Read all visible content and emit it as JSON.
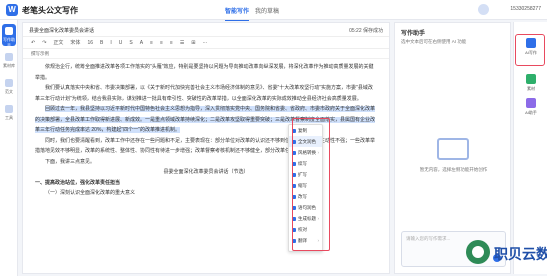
{
  "app": {
    "title": "老笔头公文写作",
    "logo": "W"
  },
  "tabs": [
    {
      "label": "智能写作"
    },
    {
      "label": "我的草稿"
    }
  ],
  "user": {
    "id": "15330258277"
  },
  "leftnav": [
    {
      "label": "写作助手"
    },
    {
      "label": "素材库"
    },
    {
      "label": "范文"
    },
    {
      "label": "工具"
    }
  ],
  "editor": {
    "doc_title": "县委全面深化改革委员会讲话",
    "save_time": "05:22 保存成功",
    "toolbar": [
      "↶",
      "↷",
      "正文",
      "宋体",
      "16",
      "B",
      "I",
      "U",
      "S",
      "A",
      "≡",
      "≡",
      "≡",
      "☰",
      "⊞",
      "⋯"
    ],
    "subbar": "撰写示例",
    "paragraphs": [
      {
        "text": "依规治企行，统筹全面推进改革各项工作落实的\"头雁\"效应，特别是要坚持以问题为导向推动改革向纵深发展，将深化改革作为推动高质量发展的关键举措。",
        "hl": false
      },
      {
        "text": "我们要认真落实中央和省、市委决策部署，以《关于新时代加快完善社会主义市场经济体制的意见》、省委\"十大改革攻坚行动\"实施方案，市委\"县域改革三年行动计划\"为统领，结合我县实际，谋划推进一批具有牵引性、突破性的改革举措，以全面深化改革的实际成效推动全县经济社会高质量发展。",
        "hl": false
      },
      {
        "text": "回顾过去一年，我县坚持以习近平新时代中国特色社会主义思想为指导，深入贯彻落实党中央、国务院和省委、省政府、市委市政府关于全面深化改革的决策部署，全县改革工作取得新进展、新成效。一是重点领域改革持续深化；二是改革攻坚取得重要突破；三是改革督察制度全面落实，县属国有企业改革三年行动任务完成率达 20%，构建起\"四个一\"的改革推进机制。",
        "hl": true
      },
      {
        "text": "同时，我们也要清醒看到，改革工作中还存在一些问题和不足，主要表现在：部分单位对改革的认识还不够到位，推进改革的主动性不强；一些改革举措落地见效不够明显，改革的系统性、整体性、协同性有待进一步增强；改革督察考核机制还不够健全，部分改革任务推进缓慢。",
        "hl": false
      },
      {
        "text": "下面，我讲三点意见。",
        "hl": false
      },
      {
        "text": "一、提高政治站位，强化改革责任担当",
        "hl": false,
        "bold": true
      },
      {
        "text": "（一）深刻认识全面深化改革的重大意义",
        "hl": false
      }
    ],
    "center_line": "县委全面深化改革委员会讲话（节选）"
  },
  "context_menu": [
    {
      "label": "复制"
    },
    {
      "label": "全文润色"
    },
    {
      "label": "风格转换",
      "arrow": "›"
    },
    {
      "label": "续写"
    },
    {
      "label": "扩写"
    },
    {
      "label": "缩写"
    },
    {
      "label": "改写"
    },
    {
      "label": "语句润色"
    },
    {
      "label": "生成标题",
      "arrow": "›"
    },
    {
      "label": "校对"
    },
    {
      "label": "翻译",
      "arrow": "›"
    }
  ],
  "rpanel": {
    "tips_title": "写作助手",
    "tips_text": "选中文本后可在右侧使用 AI 功能",
    "empty_text": "暂无内容，选择左侧功能开始创作",
    "input_placeholder": "请输入您的写作需求..."
  },
  "rstrip": [
    {
      "label": "AI写作",
      "color": "#2f6fe8"
    },
    {
      "label": "素材",
      "color": "#2eaf6b"
    },
    {
      "label": "AI助手",
      "color": "#8c6be8"
    }
  ],
  "watermark": {
    "text": "职贝云数"
  }
}
